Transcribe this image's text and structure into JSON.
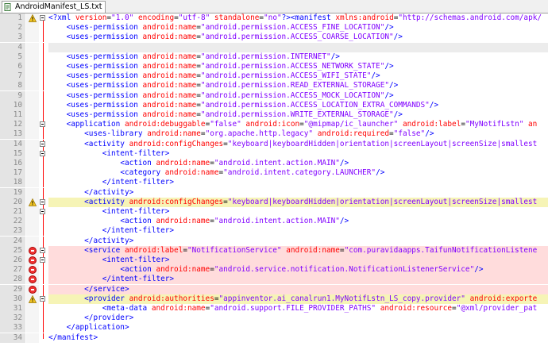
{
  "tab": {
    "title": "AndroidManifest_LS.txt"
  },
  "lines": [
    {
      "n": "1",
      "bg": "plain",
      "marker": "warn",
      "fold": "open",
      "segs": [
        [
          "pi",
          "<?xml "
        ],
        [
          "attr",
          "version"
        ],
        [
          "plain",
          "="
        ],
        [
          "val",
          "\"1.0\""
        ],
        [
          "plain",
          " "
        ],
        [
          "attr",
          "encoding"
        ],
        [
          "plain",
          "="
        ],
        [
          "val",
          "\"utf-8\""
        ],
        [
          "plain",
          " "
        ],
        [
          "attr",
          "standalone"
        ],
        [
          "plain",
          "="
        ],
        [
          "val",
          "\"no\""
        ],
        [
          "pi",
          "?>"
        ],
        [
          "tag",
          "<manifest "
        ],
        [
          "attr",
          "xmlns:android"
        ],
        [
          "plain",
          "="
        ],
        [
          "val",
          "\"http://schemas.android.com/apk/"
        ]
      ]
    },
    {
      "n": "2",
      "bg": "plain",
      "marker": "",
      "fold": "line",
      "segs": [
        [
          "plain",
          "    "
        ],
        [
          "tag",
          "<uses-permission "
        ],
        [
          "attr",
          "android:name"
        ],
        [
          "plain",
          "="
        ],
        [
          "val",
          "\"android.permission.ACCESS_FINE_LOCATION\""
        ],
        [
          "tag",
          "/>"
        ]
      ]
    },
    {
      "n": "3",
      "bg": "plain",
      "marker": "",
      "fold": "line",
      "segs": [
        [
          "plain",
          "    "
        ],
        [
          "tag",
          "<uses-permission "
        ],
        [
          "attr",
          "android:name"
        ],
        [
          "plain",
          "="
        ],
        [
          "val",
          "\"android.permission.ACCESS_COARSE_LOCATION\""
        ],
        [
          "tag",
          "/>"
        ]
      ]
    },
    {
      "n": "4",
      "bg": "gray",
      "marker": "",
      "fold": "line",
      "segs": []
    },
    {
      "n": "5",
      "bg": "plain",
      "marker": "",
      "fold": "line",
      "segs": [
        [
          "plain",
          "    "
        ],
        [
          "tag",
          "<uses-permission "
        ],
        [
          "attr",
          "android:name"
        ],
        [
          "plain",
          "="
        ],
        [
          "val",
          "\"android.permission.INTERNET\""
        ],
        [
          "tag",
          "/>"
        ]
      ]
    },
    {
      "n": "6",
      "bg": "plain",
      "marker": "",
      "fold": "line",
      "segs": [
        [
          "plain",
          "    "
        ],
        [
          "tag",
          "<uses-permission "
        ],
        [
          "attr",
          "android:name"
        ],
        [
          "plain",
          "="
        ],
        [
          "val",
          "\"android.permission.ACCESS_NETWORK_STATE\""
        ],
        [
          "tag",
          "/>"
        ]
      ]
    },
    {
      "n": "7",
      "bg": "plain",
      "marker": "",
      "fold": "line",
      "segs": [
        [
          "plain",
          "    "
        ],
        [
          "tag",
          "<uses-permission "
        ],
        [
          "attr",
          "android:name"
        ],
        [
          "plain",
          "="
        ],
        [
          "val",
          "\"android.permission.ACCESS_WIFI_STATE\""
        ],
        [
          "tag",
          "/>"
        ]
      ]
    },
    {
      "n": "8",
      "bg": "plain",
      "marker": "",
      "fold": "line",
      "segs": [
        [
          "plain",
          "    "
        ],
        [
          "tag",
          "<uses-permission "
        ],
        [
          "attr",
          "android:name"
        ],
        [
          "plain",
          "="
        ],
        [
          "val",
          "\"android.permission.READ_EXTERNAL_STORAGE\""
        ],
        [
          "tag",
          "/>"
        ]
      ]
    },
    {
      "n": "9",
      "bg": "plain",
      "marker": "",
      "fold": "line",
      "segs": [
        [
          "plain",
          "    "
        ],
        [
          "tag",
          "<uses-permission "
        ],
        [
          "attr",
          "android:name"
        ],
        [
          "plain",
          "="
        ],
        [
          "val",
          "\"android.permission.ACCESS_MOCK_LOCATION\""
        ],
        [
          "tag",
          "/>"
        ]
      ]
    },
    {
      "n": "10",
      "bg": "plain",
      "marker": "",
      "fold": "line",
      "segs": [
        [
          "plain",
          "    "
        ],
        [
          "tag",
          "<uses-permission "
        ],
        [
          "attr",
          "android:name"
        ],
        [
          "plain",
          "="
        ],
        [
          "val",
          "\"android.permission.ACCESS_LOCATION_EXTRA_COMMANDS\""
        ],
        [
          "tag",
          "/>"
        ]
      ]
    },
    {
      "n": "11",
      "bg": "plain",
      "marker": "",
      "fold": "line",
      "segs": [
        [
          "plain",
          "    "
        ],
        [
          "tag",
          "<uses-permission "
        ],
        [
          "attr",
          "android:name"
        ],
        [
          "plain",
          "="
        ],
        [
          "val",
          "\"android.permission.WRITE_EXTERNAL_STORAGE\""
        ],
        [
          "tag",
          "/>"
        ]
      ]
    },
    {
      "n": "12",
      "bg": "plain",
      "marker": "",
      "fold": "open",
      "segs": [
        [
          "plain",
          "    "
        ],
        [
          "tag",
          "<application "
        ],
        [
          "attr",
          "android:debuggable"
        ],
        [
          "plain",
          "="
        ],
        [
          "val",
          "\"false\""
        ],
        [
          "plain",
          " "
        ],
        [
          "attr",
          "android:icon"
        ],
        [
          "plain",
          "="
        ],
        [
          "val",
          "\"@mipmap/ic_launcher\""
        ],
        [
          "plain",
          " "
        ],
        [
          "attr",
          "android:label"
        ],
        [
          "plain",
          "="
        ],
        [
          "val",
          "\"MyNotifLstn\""
        ],
        [
          "plain",
          " "
        ],
        [
          "attr",
          "an"
        ]
      ]
    },
    {
      "n": "13",
      "bg": "plain",
      "marker": "",
      "fold": "line",
      "segs": [
        [
          "plain",
          "        "
        ],
        [
          "tag",
          "<uses-library "
        ],
        [
          "attr",
          "android:name"
        ],
        [
          "plain",
          "="
        ],
        [
          "val",
          "\"org.apache.http.legacy\""
        ],
        [
          "plain",
          " "
        ],
        [
          "attr",
          "android:required"
        ],
        [
          "plain",
          "="
        ],
        [
          "val",
          "\"false\""
        ],
        [
          "tag",
          "/>"
        ]
      ]
    },
    {
      "n": "14",
      "bg": "plain",
      "marker": "",
      "fold": "open",
      "segs": [
        [
          "plain",
          "        "
        ],
        [
          "tag",
          "<activity "
        ],
        [
          "attr",
          "android:configChanges"
        ],
        [
          "plain",
          "="
        ],
        [
          "val",
          "\"keyboard|keyboardHidden|orientation|screenLayout|screenSize|smallest"
        ]
      ]
    },
    {
      "n": "15",
      "bg": "plain",
      "marker": "",
      "fold": "open",
      "segs": [
        [
          "plain",
          "            "
        ],
        [
          "tag",
          "<intent-filter>"
        ]
      ]
    },
    {
      "n": "16",
      "bg": "plain",
      "marker": "",
      "fold": "line",
      "segs": [
        [
          "plain",
          "                "
        ],
        [
          "tag",
          "<action "
        ],
        [
          "attr",
          "android:name"
        ],
        [
          "plain",
          "="
        ],
        [
          "val",
          "\"android.intent.action.MAIN\""
        ],
        [
          "tag",
          "/>"
        ]
      ]
    },
    {
      "n": "17",
      "bg": "plain",
      "marker": "",
      "fold": "line",
      "segs": [
        [
          "plain",
          "                "
        ],
        [
          "tag",
          "<category "
        ],
        [
          "attr",
          "android:name"
        ],
        [
          "plain",
          "="
        ],
        [
          "val",
          "\"android.intent.category.LAUNCHER\""
        ],
        [
          "tag",
          "/>"
        ]
      ]
    },
    {
      "n": "18",
      "bg": "plain",
      "marker": "",
      "fold": "end",
      "segs": [
        [
          "plain",
          "            "
        ],
        [
          "tag",
          "</intent-filter>"
        ]
      ]
    },
    {
      "n": "19",
      "bg": "plain",
      "marker": "",
      "fold": "end",
      "segs": [
        [
          "plain",
          "        "
        ],
        [
          "tag",
          "</activity>"
        ]
      ]
    },
    {
      "n": "20",
      "bg": "yellow",
      "marker": "warn",
      "fold": "open",
      "segs": [
        [
          "plain",
          "        "
        ],
        [
          "tag",
          "<activity "
        ],
        [
          "attr",
          "android:configChanges"
        ],
        [
          "plain",
          "="
        ],
        [
          "val",
          "\"keyboard|keyboardHidden|orientation|screenLayout|screenSize|smallest"
        ]
      ]
    },
    {
      "n": "21",
      "bg": "plain",
      "marker": "",
      "fold": "open",
      "segs": [
        [
          "plain",
          "            "
        ],
        [
          "tag",
          "<intent-filter>"
        ]
      ]
    },
    {
      "n": "22",
      "bg": "plain",
      "marker": "",
      "fold": "line",
      "segs": [
        [
          "plain",
          "                "
        ],
        [
          "tag",
          "<action "
        ],
        [
          "attr",
          "android:name"
        ],
        [
          "plain",
          "="
        ],
        [
          "val",
          "\"android.intent.action.MAIN\""
        ],
        [
          "tag",
          "/>"
        ]
      ]
    },
    {
      "n": "23",
      "bg": "plain",
      "marker": "",
      "fold": "end",
      "segs": [
        [
          "plain",
          "            "
        ],
        [
          "tag",
          "</intent-filter>"
        ]
      ]
    },
    {
      "n": "24",
      "bg": "plain",
      "marker": "",
      "fold": "end",
      "segs": [
        [
          "plain",
          "        "
        ],
        [
          "tag",
          "</activity>"
        ]
      ]
    },
    {
      "n": "25",
      "bg": "pink",
      "marker": "err",
      "fold": "open",
      "segs": [
        [
          "plain",
          "        "
        ],
        [
          "tag",
          "<service "
        ],
        [
          "attr",
          "android:label"
        ],
        [
          "plain",
          "="
        ],
        [
          "val",
          "\"NotificationService\""
        ],
        [
          "plain",
          " "
        ],
        [
          "attr",
          "android:name"
        ],
        [
          "plain",
          "="
        ],
        [
          "val",
          "\"com.puravidaapps.TaifunNotificationListene"
        ]
      ]
    },
    {
      "n": "26",
      "bg": "pink",
      "marker": "err",
      "fold": "open",
      "segs": [
        [
          "plain",
          "            "
        ],
        [
          "tag",
          "<intent-filter>"
        ]
      ]
    },
    {
      "n": "27",
      "bg": "pink",
      "marker": "err",
      "fold": "line",
      "segs": [
        [
          "plain",
          "                "
        ],
        [
          "tag",
          "<action "
        ],
        [
          "attr",
          "android:name"
        ],
        [
          "plain",
          "="
        ],
        [
          "val",
          "\"android.service.notification.NotificationListenerService\""
        ],
        [
          "tag",
          "/>"
        ]
      ]
    },
    {
      "n": "28",
      "bg": "pink",
      "marker": "err",
      "fold": "end",
      "segs": [
        [
          "plain",
          "            "
        ],
        [
          "tag",
          "</intent-filter>"
        ]
      ]
    },
    {
      "n": "29",
      "bg": "pink",
      "marker": "err",
      "fold": "end",
      "segs": [
        [
          "plain",
          "        "
        ],
        [
          "tag",
          "</service>"
        ]
      ]
    },
    {
      "n": "30",
      "bg": "yellow",
      "marker": "warn",
      "fold": "open",
      "segs": [
        [
          "plain",
          "        "
        ],
        [
          "tag",
          "<provider "
        ],
        [
          "attr",
          "android:authorities"
        ],
        [
          "plain",
          "="
        ],
        [
          "val",
          "\"appinventor.ai_canalrun1.MyNotifLstn_LS_copy.provider\""
        ],
        [
          "plain",
          " "
        ],
        [
          "attr",
          "android:exporte"
        ]
      ]
    },
    {
      "n": "31",
      "bg": "plain",
      "marker": "",
      "fold": "line",
      "segs": [
        [
          "plain",
          "            "
        ],
        [
          "tag",
          "<meta-data "
        ],
        [
          "attr",
          "android:name"
        ],
        [
          "plain",
          "="
        ],
        [
          "val",
          "\"android.support.FILE_PROVIDER_PATHS\""
        ],
        [
          "plain",
          " "
        ],
        [
          "attr",
          "android:resource"
        ],
        [
          "plain",
          "="
        ],
        [
          "val",
          "\"@xml/provider_pat"
        ]
      ]
    },
    {
      "n": "32",
      "bg": "plain",
      "marker": "",
      "fold": "end",
      "segs": [
        [
          "plain",
          "        "
        ],
        [
          "tag",
          "</provider>"
        ]
      ]
    },
    {
      "n": "33",
      "bg": "plain",
      "marker": "",
      "fold": "end",
      "segs": [
        [
          "plain",
          "    "
        ],
        [
          "tag",
          "</application>"
        ]
      ]
    },
    {
      "n": "34",
      "bg": "plain",
      "marker": "",
      "fold": "end",
      "segs": [
        [
          "tag",
          "</manifest>"
        ]
      ]
    }
  ]
}
